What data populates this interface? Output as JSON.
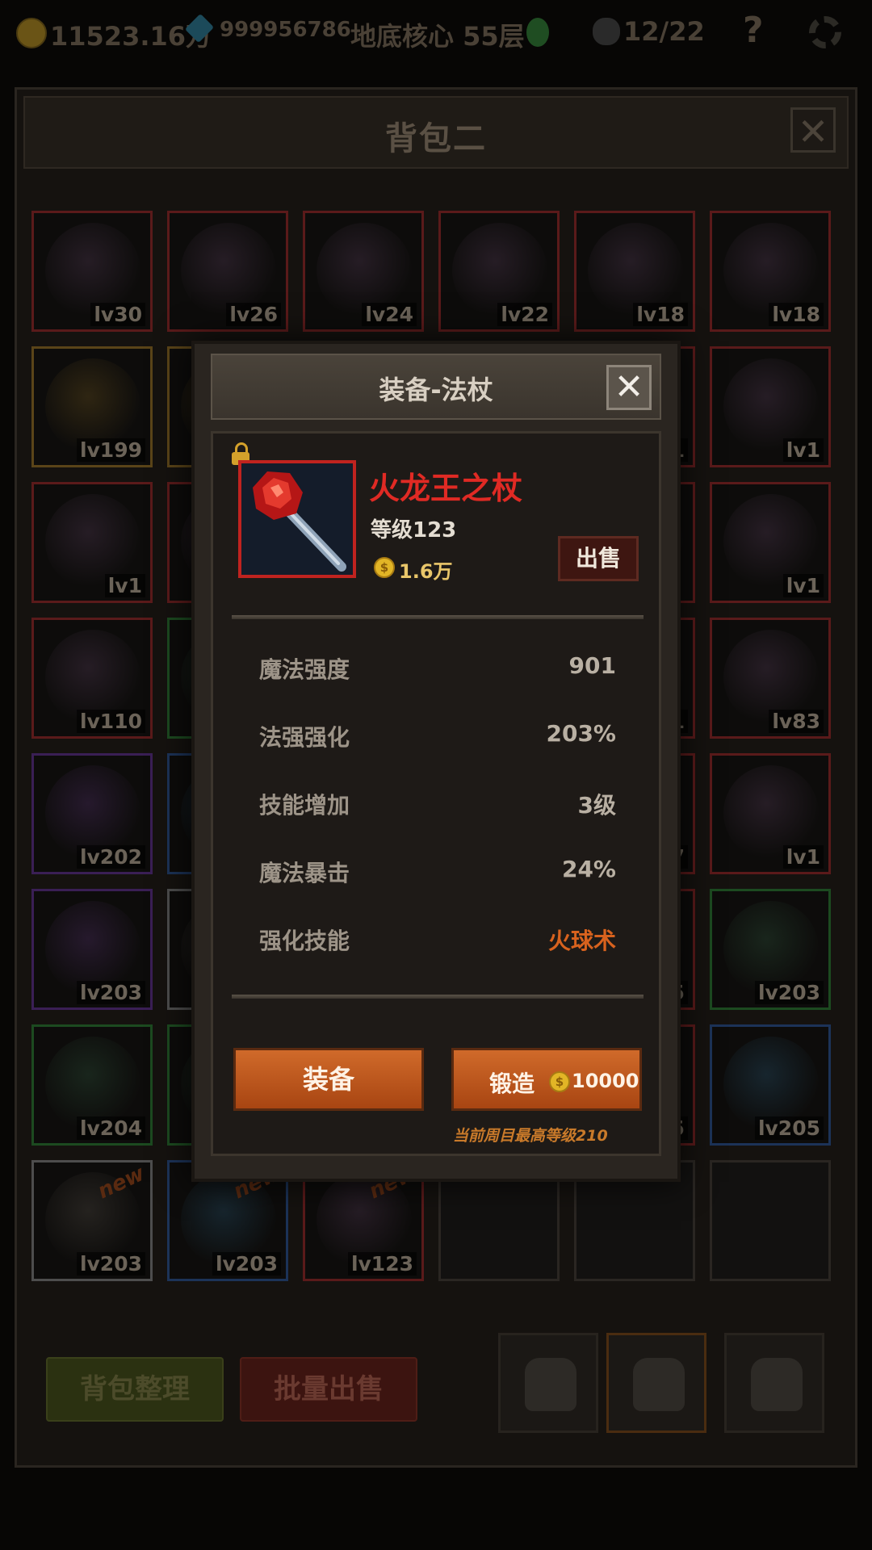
{
  "status_bar": {
    "gold": "11523.16万",
    "gems": "999956786",
    "location": "地底核心 55层",
    "kills": "12/22",
    "help": "?"
  },
  "bag": {
    "title": "背包二",
    "close": "✕",
    "slots": [
      {
        "level": "lv30",
        "quality": "red"
      },
      {
        "level": "lv26",
        "quality": "red"
      },
      {
        "level": "lv24",
        "quality": "red"
      },
      {
        "level": "lv22",
        "quality": "red"
      },
      {
        "level": "lv18",
        "quality": "red"
      },
      {
        "level": "lv18",
        "quality": "red"
      },
      {
        "level": "lv199",
        "quality": "gold"
      },
      {
        "level": "",
        "quality": "gold"
      },
      {
        "level": "",
        "quality": "red"
      },
      {
        "level": "",
        "quality": "red"
      },
      {
        "level": "1",
        "quality": "red"
      },
      {
        "level": "lv1",
        "quality": "red"
      },
      {
        "level": "lv1",
        "quality": "red"
      },
      {
        "level": "",
        "quality": "red"
      },
      {
        "level": "",
        "quality": "red"
      },
      {
        "level": "",
        "quality": "red"
      },
      {
        "level": "",
        "quality": "red"
      },
      {
        "level": "lv1",
        "quality": "red"
      },
      {
        "level": "lv110",
        "quality": "red"
      },
      {
        "level": "",
        "quality": "green"
      },
      {
        "level": "",
        "quality": "red"
      },
      {
        "level": "",
        "quality": "red"
      },
      {
        "level": "21",
        "quality": "red"
      },
      {
        "level": "lv83",
        "quality": "red"
      },
      {
        "level": "lv202",
        "quality": "purple"
      },
      {
        "level": "",
        "quality": "blue"
      },
      {
        "level": "",
        "quality": "red"
      },
      {
        "level": "",
        "quality": "red"
      },
      {
        "level": "7",
        "quality": "red"
      },
      {
        "level": "lv1",
        "quality": "red"
      },
      {
        "level": "lv203",
        "quality": "purple"
      },
      {
        "level": "",
        "quality": "white"
      },
      {
        "level": "",
        "quality": "red"
      },
      {
        "level": "",
        "quality": "red"
      },
      {
        "level": "5",
        "quality": "red"
      },
      {
        "level": "lv203",
        "quality": "green"
      },
      {
        "level": "lv204",
        "quality": "green"
      },
      {
        "level": "",
        "quality": "green"
      },
      {
        "level": "",
        "quality": "red"
      },
      {
        "level": "",
        "quality": "red"
      },
      {
        "level": "05",
        "quality": "red"
      },
      {
        "level": "lv205",
        "quality": "blue"
      },
      {
        "level": "lv203",
        "quality": "white",
        "new": "new"
      },
      {
        "level": "lv203",
        "quality": "blue",
        "new": "new"
      },
      {
        "level": "lv123",
        "quality": "red",
        "new": "new"
      },
      {
        "level": "",
        "quality": "empty"
      },
      {
        "level": "",
        "quality": "empty"
      },
      {
        "level": "",
        "quality": "empty"
      }
    ],
    "sort_button": "背包整理",
    "bulk_sell_button": "批量出售"
  },
  "dialog": {
    "title": "装备-法杖",
    "close": "✕",
    "item": {
      "name": "火龙王之杖",
      "level": "等级123",
      "price": "1.6万",
      "coin_symbol": "$",
      "sell": "出售"
    },
    "stats": [
      {
        "label": "魔法强度",
        "value": "901"
      },
      {
        "label": "法强强化",
        "value": "203%"
      },
      {
        "label": "技能增加",
        "value": "3级"
      },
      {
        "label": "魔法暴击",
        "value": "24%"
      },
      {
        "label": "强化技能",
        "value": "火球术"
      }
    ],
    "equip_button": "装备",
    "forge_button": "锻造",
    "forge_cost": "10000",
    "max_level_note": "当前周目最高等级210"
  },
  "colors": {
    "item_name": "#e02a24",
    "skill_value": "#d8621e",
    "button_orange": "#c25a1f"
  }
}
